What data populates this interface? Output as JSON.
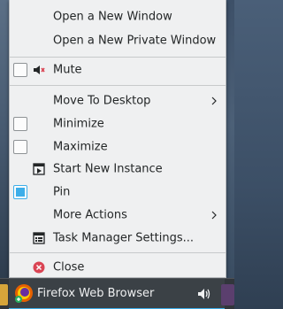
{
  "menu": {
    "items": [
      {
        "id": "open-window",
        "label": "Open a New Window"
      },
      {
        "id": "open-private",
        "label": "Open a New Private Window"
      },
      {
        "id": "mute",
        "label": "Mute",
        "checked": false,
        "icon": "speaker-muted-icon"
      },
      {
        "id": "move-desktop",
        "label": "Move To Desktop",
        "submenu": true
      },
      {
        "id": "minimize",
        "label": "Minimize",
        "checked": false
      },
      {
        "id": "maximize",
        "label": "Maximize",
        "checked": false
      },
      {
        "id": "new-instance",
        "label": "Start New Instance",
        "icon": "new-instance-icon"
      },
      {
        "id": "pin",
        "label": "Pin",
        "checked": true
      },
      {
        "id": "more-actions",
        "label": "More Actions",
        "submenu": true
      },
      {
        "id": "tm-settings",
        "label": "Task Manager Settings...",
        "icon": "settings-icon"
      },
      {
        "id": "close",
        "label": "Close",
        "icon": "close-icon"
      }
    ]
  },
  "taskbar": {
    "active_task": {
      "title": "Firefox Web Browser",
      "icon": "firefox-icon"
    },
    "tray_icon": "speaker-icon"
  },
  "colors": {
    "accent": "#3daee9",
    "menu_bg": "#eff0f1",
    "taskbar_bg": "#31363b",
    "close_red": "#da4453"
  }
}
